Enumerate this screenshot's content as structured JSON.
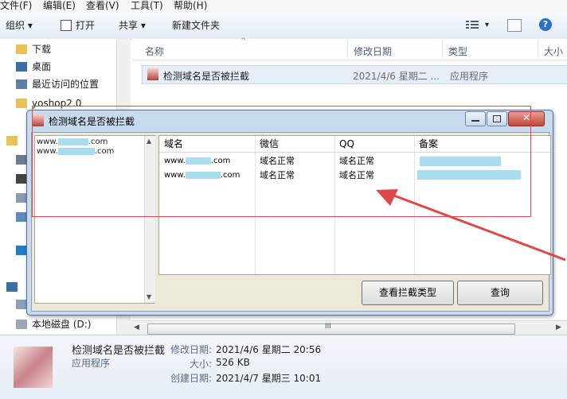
{
  "menu": {
    "file": "文件(F)",
    "edit": "编辑(E)",
    "view": "查看(V)",
    "tools": "工具(T)",
    "help": "帮助(H)"
  },
  "toolbar": {
    "organize": "组织 ▾",
    "open": "打开",
    "share": "共享 ▾",
    "new_folder": "新建文件夹"
  },
  "nav": {
    "items": [
      "下载",
      "桌面",
      "最近访问的位置",
      "yoshop2.0"
    ],
    "drive": "本地磁盘 (D:)"
  },
  "columns": {
    "name": "名称",
    "modified": "修改日期",
    "type": "类型",
    "size": "大小"
  },
  "file": {
    "name": "检测域名是否被拦截",
    "modified": "2021/4/6 星期二 ...",
    "type": "应用程序"
  },
  "details": {
    "name": "检测域名是否被拦截",
    "kind": "应用程序",
    "modified_label": "修改日期:",
    "modified_value": "2021/4/6 星期二 20:56",
    "size_label": "大小:",
    "size_value": "526 KB",
    "created_label": "创建日期:",
    "created_value": "2021/4/7 星期三 10:01"
  },
  "dialog": {
    "title": "检测域名是否被拦截",
    "left_list": [
      {
        "prefix": "www.",
        "suffix": ".com"
      },
      {
        "prefix": "www.",
        "suffix": ".com"
      }
    ],
    "grid_headers": {
      "domain": "域名",
      "wechat": "微信",
      "qq": "QQ",
      "record": "备案"
    },
    "rows": [
      {
        "prefix": "www.",
        "suffix": ".com",
        "wechat": "域名正常",
        "qq": "域名正常"
      },
      {
        "prefix": "www.",
        "suffix": ".com",
        "wechat": "域名正常",
        "qq": "域名正常"
      }
    ],
    "btn_view_type": "查看拦截类型",
    "btn_query": "查询"
  },
  "scroll": {
    "grip": "III"
  },
  "colors": {
    "accent": "#3a7bd5",
    "annotation": "#e04848",
    "redaction": "#a8dcee"
  }
}
